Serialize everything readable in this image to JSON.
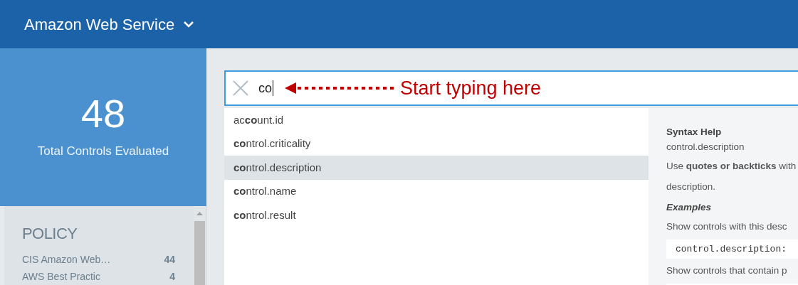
{
  "header": {
    "title": "Amazon Web Service"
  },
  "summary": {
    "count": "48",
    "label": "Total Controls Evaluated"
  },
  "policy": {
    "title": "POLICY",
    "items": [
      {
        "name": "CIS Amazon Web…",
        "count": "44"
      },
      {
        "name": "AWS Best Practic",
        "count": "4"
      }
    ]
  },
  "search": {
    "value": "co"
  },
  "annotation": {
    "text": "Start typing here"
  },
  "suggestions": [
    {
      "text": "ac**co**unt.id",
      "selected": false
    },
    {
      "text": "**co**ntrol.criticality",
      "selected": false
    },
    {
      "text": "**co**ntrol.description",
      "selected": true
    },
    {
      "text": "**co**ntrol.name",
      "selected": false
    },
    {
      "text": "**co**ntrol.result",
      "selected": false
    }
  ],
  "syntax_help": {
    "title": "Syntax Help",
    "field": "control.description",
    "lines": [
      {
        "kind": "text",
        "text": "Use **quotes or backticks** with"
      },
      {
        "kind": "text",
        "text": "description."
      },
      {
        "kind": "heading",
        "text": "Examples"
      },
      {
        "kind": "text",
        "text": "Show controls with this desc"
      },
      {
        "kind": "code",
        "text": "control.description:"
      },
      {
        "kind": "text",
        "text": "Show controls that contain p"
      },
      {
        "kind": "code"
      }
    ]
  }
}
